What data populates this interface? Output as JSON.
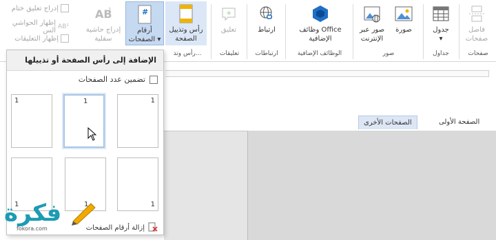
{
  "ribbon": {
    "buttons": [
      {
        "label": "فاصل\nصفحات",
        "icon": "page-break-icon"
      },
      {
        "label": "جدول\n▾",
        "icon": "table-icon"
      },
      {
        "label": "صورة",
        "icon": "picture-icon"
      },
      {
        "label": "صور عبر\nالإنترنت",
        "icon": "online-pictures-icon"
      },
      {
        "label": "وظائف Office\nالإضافية",
        "icon": "office-addins-icon"
      },
      {
        "label": "ارتباط",
        "icon": "link-icon"
      },
      {
        "label": "تعليق",
        "icon": "comment-icon"
      },
      {
        "label": "رأس وتذييل\nالصفحة",
        "icon": "header-footer-icon"
      },
      {
        "label": "أرقام\nالصفحات ▾",
        "icon": "page-number-icon"
      },
      {
        "label": "إدراج حاشية\nسفلية",
        "icon": "footnote-icon"
      }
    ],
    "groups": [
      "صفحات",
      "جداول",
      "صور",
      "الوظائف الإضافية",
      "ارتباطات",
      "تعليقات",
      "رأس وتذ..."
    ],
    "mini": {
      "insert_comment": "إدراج تعليق ختام",
      "show_markup": "إظهار الحواشي الس",
      "show_comments": "إظهار التعليقات"
    }
  },
  "doc": {
    "tab_first": "الصفحة الأولى",
    "tab_other": "الصفحات الأخرى"
  },
  "dropdown": {
    "title": "الإضافة إلى رأس الصفحة أو تذييلها",
    "checkbox_label": "تضمين عدد الصفحات",
    "page_number": "1",
    "remove_label": "إزالة أرقام الصفحات"
  },
  "watermark": {
    "text": "فكرة",
    "url": "fokora.com"
  },
  "colors": {
    "active": "#c5d9f1",
    "accent": "#1d9bb3",
    "office_blue": "#1f6fc5"
  }
}
